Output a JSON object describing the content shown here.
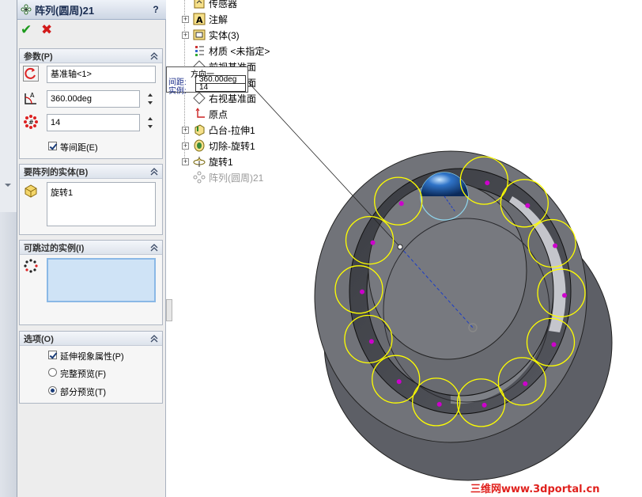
{
  "property_manager": {
    "title": "阵列(圆周)21",
    "help_label": "?",
    "ok_label": "✔",
    "cancel_label": "✖",
    "params": {
      "header": "参数(P)",
      "axis_value": "基准轴<1>",
      "angle_value": "360.00deg",
      "count_value": "14",
      "equal_spacing_label": "等间距(E)",
      "equal_spacing_checked": true
    },
    "bodies": {
      "header": "要阵列的实体(B)",
      "items": [
        "旋转1"
      ]
    },
    "skip": {
      "header": "可跳过的实例(I)",
      "items": []
    },
    "options": {
      "header": "选项(O)",
      "propagate_label": "延伸视象属性(P)",
      "propagate_checked": true,
      "full_preview_label": "完整预览(F)",
      "partial_preview_label": "部分预览(T)",
      "selected_preview": "partial"
    }
  },
  "feature_tree": {
    "items": [
      {
        "label": "传感器",
        "expander": "none",
        "icon": "sensor-icon"
      },
      {
        "label": "注解",
        "expander": "plus",
        "icon": "annotation-icon"
      },
      {
        "label": "实体(3)",
        "expander": "plus",
        "icon": "solid-bodies-icon"
      },
      {
        "label": "材质 <未指定>",
        "expander": "none",
        "icon": "material-icon"
      },
      {
        "label": "前视基准面",
        "expander": "none",
        "icon": "plane-icon"
      },
      {
        "label": "上视基准面",
        "expander": "none",
        "icon": "plane-icon"
      },
      {
        "label": "右视基准面",
        "expander": "none",
        "icon": "plane-icon"
      },
      {
        "label": "原点",
        "expander": "none",
        "icon": "origin-icon"
      },
      {
        "label": "凸台-拉伸1",
        "expander": "plus",
        "icon": "boss-extrude-icon"
      },
      {
        "label": "切除-旋转1",
        "expander": "plus",
        "icon": "cut-revolve-icon"
      },
      {
        "label": "旋转1",
        "expander": "plus",
        "icon": "revolve-icon"
      },
      {
        "label": "阵列(圆周)21",
        "expander": "none",
        "icon": "circular-pattern-icon",
        "grayed": true
      }
    ]
  },
  "callout": {
    "title": "方向一",
    "spacing_label": "间距:",
    "spacing_value": "360.00deg",
    "instances_label": "实例:",
    "instances_value": "14"
  },
  "viewport": {
    "preview_instance_count": 14,
    "watermark": "三维网www.3dportal.cn"
  },
  "colors": {
    "preview_circle": "#ffff00",
    "instance_marker": "#cc00cc",
    "ball": "#1e5aa8",
    "model_gray": "#6e7076",
    "watermark": "#e0201c"
  }
}
